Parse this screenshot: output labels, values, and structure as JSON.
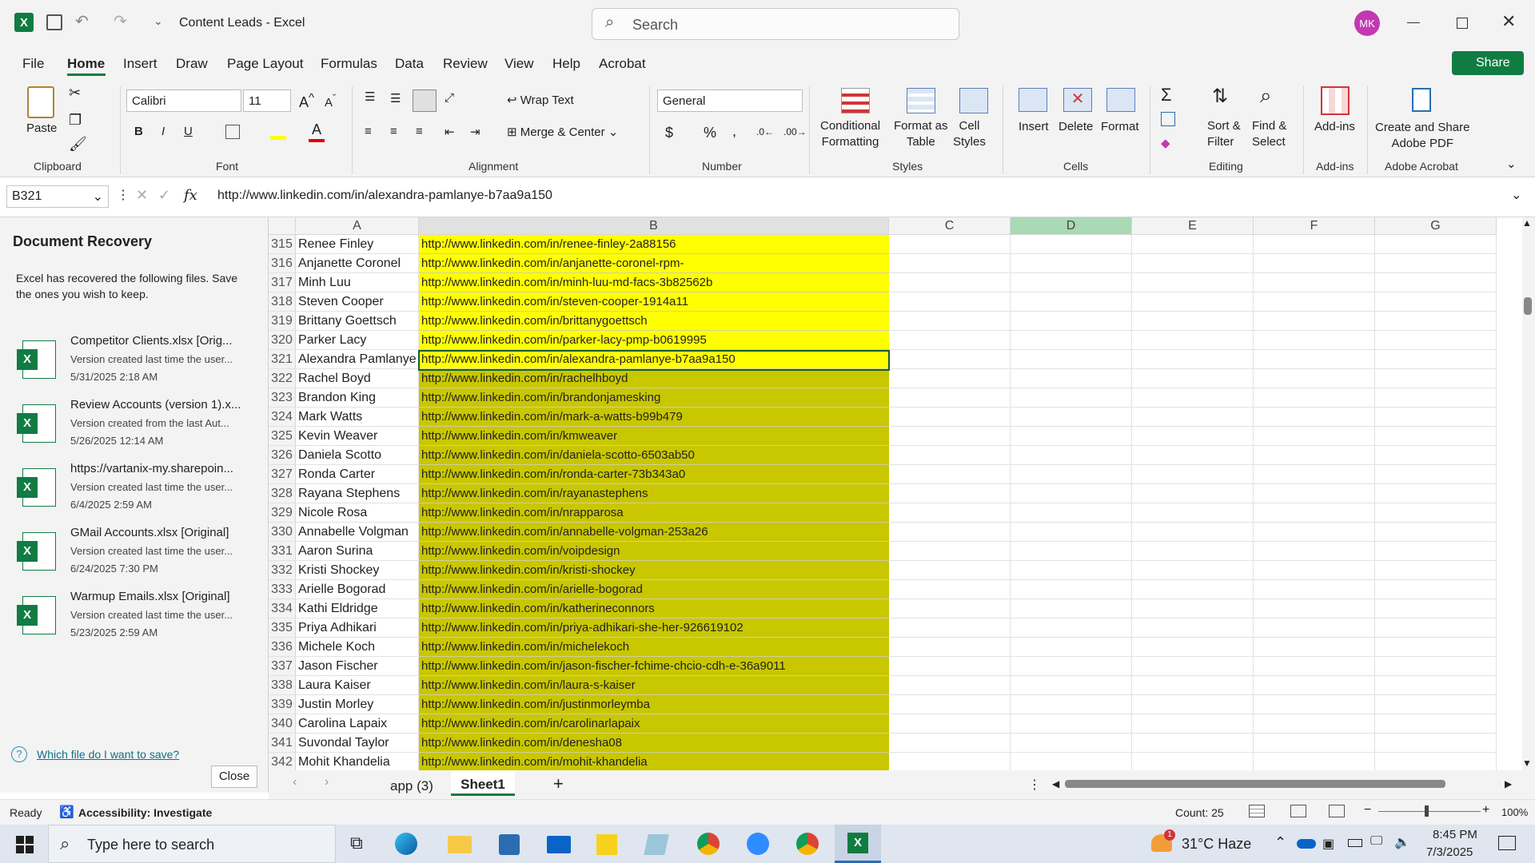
{
  "window": {
    "title": "Content Leads  -  Excel",
    "user_initials": "MK",
    "accent": "#107c41"
  },
  "search": {
    "placeholder": "Search"
  },
  "menu": {
    "items": [
      "File",
      "Home",
      "Insert",
      "Draw",
      "Page Layout",
      "Formulas",
      "Data",
      "Review",
      "View",
      "Help",
      "Acrobat"
    ],
    "active": "Home",
    "share": "Share"
  },
  "ribbon": {
    "clipboard": {
      "paste": "Paste",
      "label": "Clipboard"
    },
    "font": {
      "name": "Calibri",
      "size": "11",
      "label": "Font"
    },
    "alignment": {
      "wrap": "Wrap Text",
      "merge": "Merge & Center",
      "label": "Alignment"
    },
    "number": {
      "format": "General",
      "label": "Number"
    },
    "styles": {
      "conditional": "Conditional\nFormatting",
      "table": "Format as\nTable",
      "cell": "Cell\nStyles",
      "label": "Styles"
    },
    "cells": {
      "insert": "Insert",
      "delete": "Delete",
      "format": "Format",
      "label": "Cells"
    },
    "editing": {
      "sort": "Sort &\nFilter",
      "find": "Find &\nSelect",
      "label": "Editing"
    },
    "addins": {
      "addins": "Add-ins",
      "label": "Add-ins"
    },
    "acrobat": {
      "create": "Create and Share\nAdobe PDF",
      "label": "Adobe Acrobat"
    }
  },
  "formula_bar": {
    "name_box": "B321",
    "fx": "fx",
    "content": "http://www.linkedin.com/in/alexandra-pamlanye-b7aa9a150"
  },
  "recovery": {
    "title": "Document Recovery",
    "intro": "Excel has recovered the following files. Save the ones you wish to keep.",
    "files": [
      {
        "name": "Competitor Clients.xlsx  [Orig...",
        "desc": "Version created last time the user...",
        "date": "5/31/2025 2:18 AM"
      },
      {
        "name": "Review Accounts (version 1).x...",
        "desc": "Version created from the last Aut...",
        "date": "5/26/2025 12:14 AM"
      },
      {
        "name": "https://vartanix-my.sharepoin...",
        "desc": "Version created last time the user...",
        "date": "6/4/2025 2:59 AM"
      },
      {
        "name": "GMail Accounts.xlsx  [Original]",
        "desc": "Version created last time the user...",
        "date": "6/24/2025 7:30 PM"
      },
      {
        "name": "Warmup Emails.xlsx  [Original]",
        "desc": "Version created last time the user...",
        "date": "5/23/2025 2:59 AM"
      }
    ],
    "help_link": "Which file do I want to save?",
    "close": "Close"
  },
  "grid": {
    "columns": [
      "A",
      "B",
      "C",
      "D",
      "E",
      "F",
      "G"
    ],
    "rows": [
      {
        "n": "315",
        "a": "Renee Finley",
        "b": "http://www.linkedin.com/in/renee-finley-2a88156",
        "fill": "#ffff00"
      },
      {
        "n": "316",
        "a": "Anjanette Coronel",
        "b": "http://www.linkedin.com/in/anjanette-coronel-rpm-",
        "fill": "#ffff00"
      },
      {
        "n": "317",
        "a": "Minh Luu",
        "b": "http://www.linkedin.com/in/minh-luu-md-facs-3b82562b",
        "fill": "#ffff00"
      },
      {
        "n": "318",
        "a": "Steven Cooper",
        "b": "http://www.linkedin.com/in/steven-cooper-1914a11",
        "fill": "#ffff00"
      },
      {
        "n": "319",
        "a": "Brittany Goettsch",
        "b": "http://www.linkedin.com/in/brittanygoettsch",
        "fill": "#ffff00"
      },
      {
        "n": "320",
        "a": "Parker Lacy",
        "b": "http://www.linkedin.com/in/parker-lacy-pmp-b0619995",
        "fill": "#ffff00"
      },
      {
        "n": "321",
        "a": "Alexandra Pamlanye",
        "b": "http://www.linkedin.com/in/alexandra-pamlanye-b7aa9a150",
        "fill": "#ffff00"
      },
      {
        "n": "322",
        "a": "Rachel Boyd",
        "b": "http://www.linkedin.com/in/rachelhboyd",
        "fill": "#c9c700"
      },
      {
        "n": "323",
        "a": "Brandon King",
        "b": "http://www.linkedin.com/in/brandonjamesking",
        "fill": "#c9c700"
      },
      {
        "n": "324",
        "a": "Mark Watts",
        "b": "http://www.linkedin.com/in/mark-a-watts-b99b479",
        "fill": "#c9c700"
      },
      {
        "n": "325",
        "a": "Kevin Weaver",
        "b": "http://www.linkedin.com/in/kmweaver",
        "fill": "#c9c700"
      },
      {
        "n": "326",
        "a": "Daniela Scotto",
        "b": "http://www.linkedin.com/in/daniela-scotto-6503ab50",
        "fill": "#c9c700"
      },
      {
        "n": "327",
        "a": "Ronda Carter",
        "b": "http://www.linkedin.com/in/ronda-carter-73b343a0",
        "fill": "#c9c700"
      },
      {
        "n": "328",
        "a": "Rayana Stephens",
        "b": "http://www.linkedin.com/in/rayanastephens",
        "fill": "#c9c700"
      },
      {
        "n": "329",
        "a": "Nicole Rosa",
        "b": "http://www.linkedin.com/in/nrapparosa",
        "fill": "#c9c700"
      },
      {
        "n": "330",
        "a": "Annabelle Volgman",
        "b": "http://www.linkedin.com/in/annabelle-volgman-253a26",
        "fill": "#c9c700"
      },
      {
        "n": "331",
        "a": "Aaron Surina",
        "b": "http://www.linkedin.com/in/voipdesign",
        "fill": "#c9c700"
      },
      {
        "n": "332",
        "a": "Kristi Shockey",
        "b": "http://www.linkedin.com/in/kristi-shockey",
        "fill": "#c9c700"
      },
      {
        "n": "333",
        "a": "Arielle Bogorad",
        "b": "http://www.linkedin.com/in/arielle-bogorad",
        "fill": "#c9c700"
      },
      {
        "n": "334",
        "a": "Kathi Eldridge",
        "b": "http://www.linkedin.com/in/katherineconnors",
        "fill": "#c9c700"
      },
      {
        "n": "335",
        "a": "Priya Adhikari",
        "b": "http://www.linkedin.com/in/priya-adhikari-she-her-926619102",
        "fill": "#c9c700"
      },
      {
        "n": "336",
        "a": "Michele Koch",
        "b": "http://www.linkedin.com/in/michelekoch",
        "fill": "#c9c700"
      },
      {
        "n": "337",
        "a": "Jason Fischer",
        "b": "http://www.linkedin.com/in/jason-fischer-fchime-chcio-cdh-e-36a9011",
        "fill": "#c9c700"
      },
      {
        "n": "338",
        "a": "Laura Kaiser",
        "b": "http://www.linkedin.com/in/laura-s-kaiser",
        "fill": "#c9c700"
      },
      {
        "n": "339",
        "a": "Justin Morley",
        "b": "http://www.linkedin.com/in/justinmorleymba",
        "fill": "#c9c700"
      },
      {
        "n": "340",
        "a": "Carolina Lapaix",
        "b": "http://www.linkedin.com/in/carolinarlapaix",
        "fill": "#c9c700"
      },
      {
        "n": "341",
        "a": "Suvondal Taylor",
        "b": "http://www.linkedin.com/in/denesha08",
        "fill": "#c9c700"
      },
      {
        "n": "342",
        "a": "Mohit Khandelia",
        "b": "http://www.linkedin.com/in/mohit-khandelia",
        "fill": "#c9c700"
      }
    ]
  },
  "sheets": {
    "tabs": [
      "app (3)",
      "Sheet1"
    ],
    "active": "Sheet1"
  },
  "status": {
    "mode": "Ready",
    "accessibility": "Accessibility: Investigate",
    "count": "Count: 25",
    "zoom": "100%"
  },
  "taskbar": {
    "search_placeholder": "Type here to search",
    "weather": "31°C  Haze",
    "time": "8:45 PM",
    "date": "7/3/2025",
    "weather_badge": "1"
  }
}
